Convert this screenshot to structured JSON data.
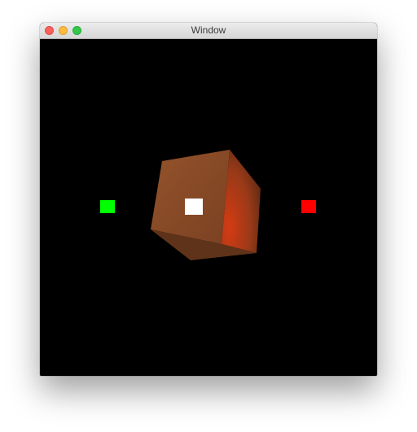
{
  "window": {
    "title": "Window",
    "controls": {
      "close": "close-icon",
      "minimize": "minimize-icon",
      "zoom": "zoom-icon"
    }
  },
  "scene": {
    "background": "#000000",
    "cube": {
      "front_face_color": "#8a4b27",
      "right_face_color": "#b8401c",
      "bottom_face_color": "#5e3219"
    },
    "markers": {
      "left": {
        "color": "#00ff00"
      },
      "center": {
        "color": "#ffffff"
      },
      "right": {
        "color": "#ff0000"
      }
    }
  }
}
